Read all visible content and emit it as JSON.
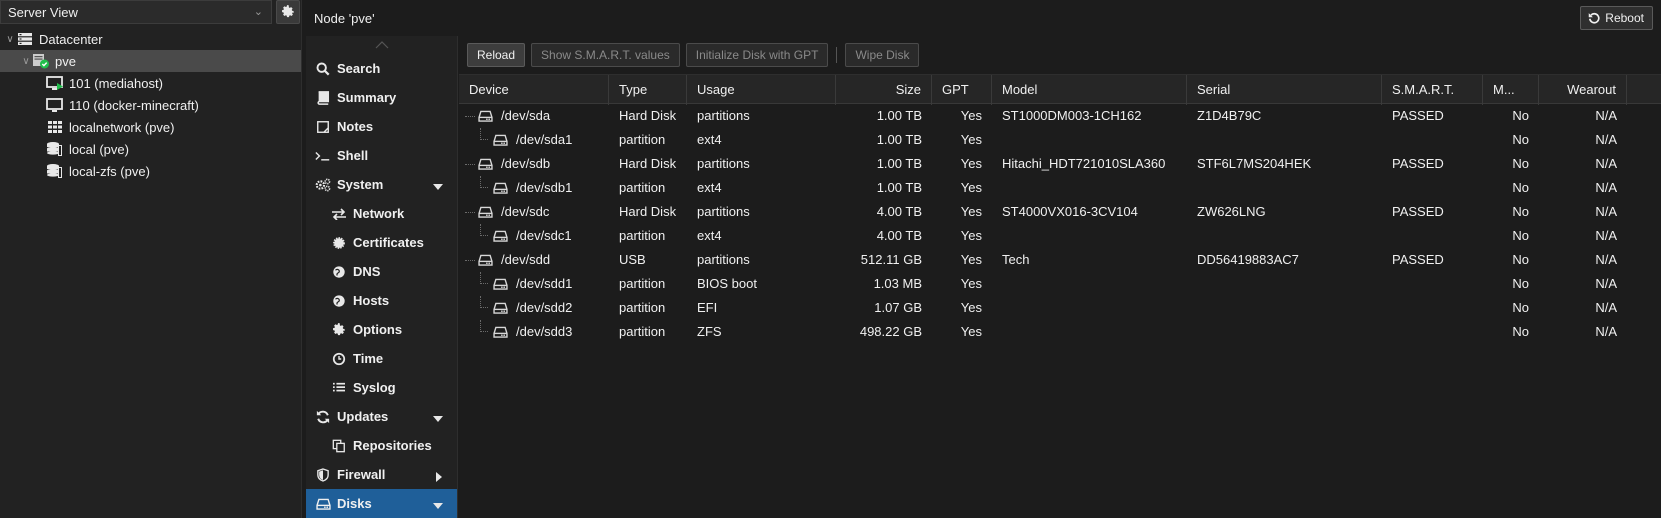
{
  "left_panel": {
    "view_label": "Server View",
    "tree": [
      {
        "label": "Datacenter",
        "level": 0,
        "icon": "datacenter-icon",
        "expander": "∨"
      },
      {
        "label": "pve",
        "level": 1,
        "icon": "node-online-icon",
        "expander": "∨",
        "selected": true
      },
      {
        "label": "101 (mediahost)",
        "level": 2,
        "icon": "vm-running-icon"
      },
      {
        "label": "110 (docker-minecraft)",
        "level": 2,
        "icon": "vm-stopped-icon"
      },
      {
        "label": "localnetwork (pve)",
        "level": 2,
        "icon": "network-grid-icon"
      },
      {
        "label": "local (pve)",
        "level": 2,
        "icon": "storage-icon"
      },
      {
        "label": "local-zfs (pve)",
        "level": 2,
        "icon": "storage-icon"
      }
    ]
  },
  "header": {
    "title": "Node 'pve'",
    "reboot_label": "Reboot"
  },
  "nav": {
    "items": [
      {
        "label": "Search",
        "icon": "search-icon",
        "sub": false
      },
      {
        "label": "Summary",
        "icon": "book-icon",
        "sub": false
      },
      {
        "label": "Notes",
        "icon": "notes-icon",
        "sub": false
      },
      {
        "label": "Shell",
        "icon": "terminal-icon",
        "sub": false
      },
      {
        "label": "System",
        "icon": "cogs-icon",
        "sub": false,
        "arrow": "down"
      },
      {
        "label": "Network",
        "icon": "exchange-icon",
        "sub": true
      },
      {
        "label": "Certificates",
        "icon": "certificate-icon",
        "sub": true
      },
      {
        "label": "DNS",
        "icon": "globe-icon",
        "sub": true
      },
      {
        "label": "Hosts",
        "icon": "globe-icon",
        "sub": true
      },
      {
        "label": "Options",
        "icon": "gear-icon",
        "sub": true
      },
      {
        "label": "Time",
        "icon": "clock-icon",
        "sub": true
      },
      {
        "label": "Syslog",
        "icon": "list-icon",
        "sub": true
      },
      {
        "label": "Updates",
        "icon": "refresh-icon",
        "sub": false,
        "arrow": "down"
      },
      {
        "label": "Repositories",
        "icon": "copy-icon",
        "sub": true
      },
      {
        "label": "Firewall",
        "icon": "shield-icon",
        "sub": false,
        "arrow": "right"
      },
      {
        "label": "Disks",
        "icon": "hdd-icon",
        "sub": false,
        "arrow": "down",
        "active": true
      }
    ]
  },
  "toolbar": {
    "reload": "Reload",
    "show_smart": "Show S.M.A.R.T. values",
    "init_gpt": "Initialize Disk with GPT",
    "wipe": "Wipe Disk"
  },
  "table": {
    "columns": [
      "Device",
      "Type",
      "Usage",
      "Size",
      "GPT",
      "Model",
      "Serial",
      "S.M.A.R.T.",
      "M...",
      "Wearout"
    ],
    "rows": [
      {
        "device": "/dev/sda",
        "child": false,
        "type": "Hard Disk",
        "usage": "partitions",
        "size": "1.00 TB",
        "gpt": "Yes",
        "model": "ST1000DM003-1CH162",
        "serial": "Z1D4B79C",
        "smart": "PASSED",
        "m": "No",
        "wear": "N/A"
      },
      {
        "device": "/dev/sda1",
        "child": true,
        "type": "partition",
        "usage": "ext4",
        "size": "1.00 TB",
        "gpt": "Yes",
        "model": "",
        "serial": "",
        "smart": "",
        "m": "No",
        "wear": "N/A"
      },
      {
        "device": "/dev/sdb",
        "child": false,
        "type": "Hard Disk",
        "usage": "partitions",
        "size": "1.00 TB",
        "gpt": "Yes",
        "model": "Hitachi_HDT721010SLA360",
        "serial": "STF6L7MS204HEK",
        "smart": "PASSED",
        "m": "No",
        "wear": "N/A"
      },
      {
        "device": "/dev/sdb1",
        "child": true,
        "type": "partition",
        "usage": "ext4",
        "size": "1.00 TB",
        "gpt": "Yes",
        "model": "",
        "serial": "",
        "smart": "",
        "m": "No",
        "wear": "N/A"
      },
      {
        "device": "/dev/sdc",
        "child": false,
        "type": "Hard Disk",
        "usage": "partitions",
        "size": "4.00 TB",
        "gpt": "Yes",
        "model": "ST4000VX016-3CV104",
        "serial": "ZW626LNG",
        "smart": "PASSED",
        "m": "No",
        "wear": "N/A"
      },
      {
        "device": "/dev/sdc1",
        "child": true,
        "type": "partition",
        "usage": "ext4",
        "size": "4.00 TB",
        "gpt": "Yes",
        "model": "",
        "serial": "",
        "smart": "",
        "m": "No",
        "wear": "N/A"
      },
      {
        "device": "/dev/sdd",
        "child": false,
        "type": "USB",
        "usage": "partitions",
        "size": "512.11 GB",
        "gpt": "Yes",
        "model": "Tech",
        "serial": "DD56419883AC7",
        "smart": "PASSED",
        "m": "No",
        "wear": "N/A"
      },
      {
        "device": "/dev/sdd1",
        "child": true,
        "type": "partition",
        "usage": "BIOS boot",
        "size": "1.03 MB",
        "gpt": "Yes",
        "model": "",
        "serial": "",
        "smart": "",
        "m": "No",
        "wear": "N/A"
      },
      {
        "device": "/dev/sdd2",
        "child": true,
        "type": "partition",
        "usage": "EFI",
        "size": "1.07 GB",
        "gpt": "Yes",
        "model": "",
        "serial": "",
        "smart": "",
        "m": "No",
        "wear": "N/A"
      },
      {
        "device": "/dev/sdd3",
        "child": true,
        "type": "partition",
        "usage": "ZFS",
        "size": "498.22 GB",
        "gpt": "Yes",
        "model": "",
        "serial": "",
        "smart": "",
        "m": "No",
        "wear": "N/A"
      }
    ]
  },
  "colors": {
    "accent": "#1f5f99",
    "background": "#1c1c1c",
    "running": "#21bf4b"
  }
}
